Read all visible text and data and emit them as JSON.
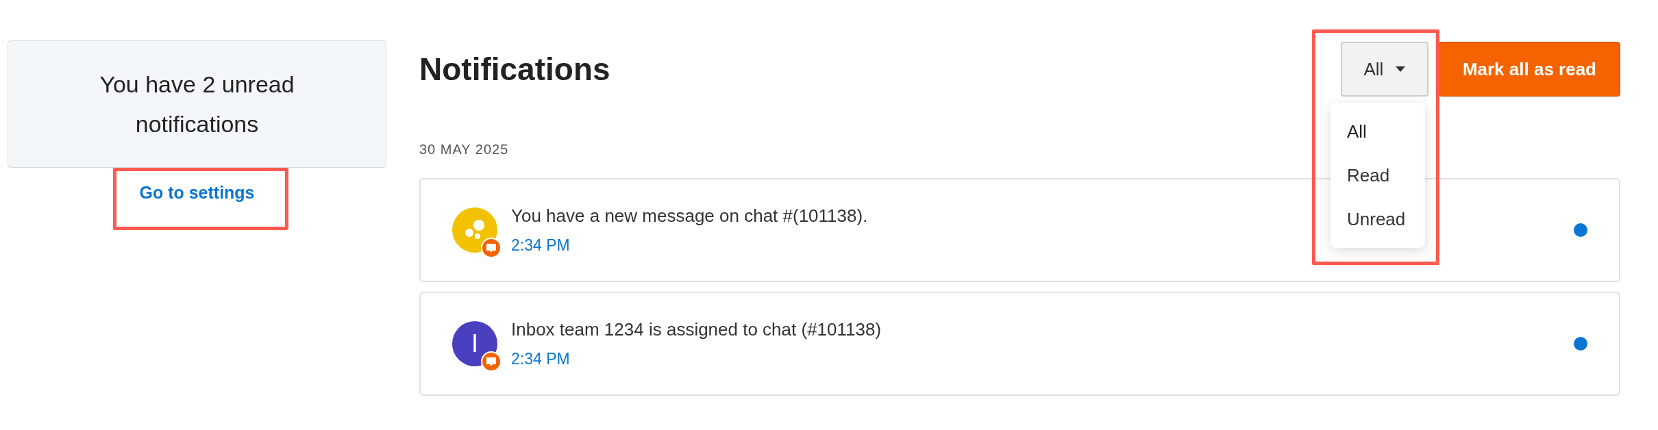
{
  "summary": {
    "text": "You have 2 unread notifications",
    "link": "Go to settings"
  },
  "header": {
    "title": "Notifications",
    "filter": {
      "value": "All",
      "expanded": true,
      "options": [
        {
          "label": "All",
          "selected": true
        },
        {
          "label": "Read",
          "selected": false
        },
        {
          "label": "Unread",
          "selected": false
        }
      ]
    },
    "mark_all_button": "Mark all as read"
  },
  "groups": [
    {
      "date": "30 MAY 2025",
      "notifications": [
        {
          "kind": "icon",
          "color": "#f2c200",
          "message": "You have a new message on chat #(101138).",
          "time": "2:34 PM",
          "unread": true
        },
        {
          "kind": "letter",
          "letter": "I",
          "color": "#4a3fbf",
          "message": "Inbox team 1234 is assigned to chat (#101138)",
          "time": "2:34 PM",
          "unread": true
        }
      ]
    }
  ]
}
